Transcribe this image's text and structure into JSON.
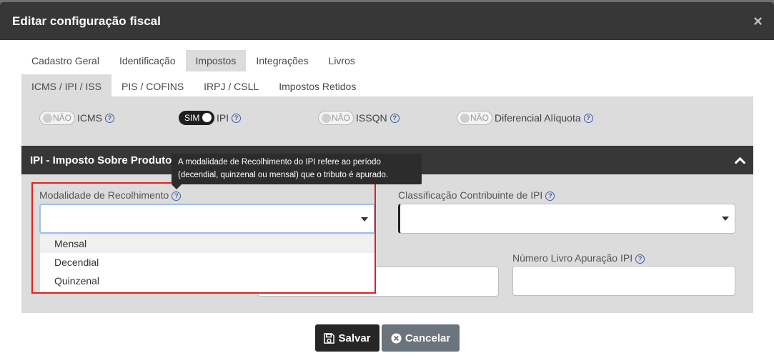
{
  "modal": {
    "title": "Editar configuração fiscal",
    "close": "×"
  },
  "tabs_main": [
    "Cadastro Geral",
    "Identificação",
    "Impostos",
    "Integrações",
    "Livros"
  ],
  "tabs_sub": [
    "ICMS / IPI / ISS",
    "PIS / COFINS",
    "IRPJ / CSLL",
    "Impostos Retidos"
  ],
  "toggles": [
    {
      "state": "NÃO",
      "label": "ICMS"
    },
    {
      "state": "SIM",
      "label": "IPI"
    },
    {
      "state": "NÃO",
      "label": "ISSQN"
    },
    {
      "state": "NÃO",
      "label": "Diferencial Alíquota"
    }
  ],
  "help_glyph": "?",
  "section": {
    "title": "IPI - Imposto Sobre Produtos"
  },
  "tooltip": {
    "line1": "A modalidade de Recolhimento do IPI refere ao período",
    "line2": "(decendial, quinzenal ou mensal) que o tributo é apurado."
  },
  "fields": {
    "modalidade_label": "Modalidade de Recolhimento",
    "classificacao_label": "Classificação Contribuinte de IPI",
    "numero_livro_label": "Número Livro Apuração IPI"
  },
  "dropdown_options": [
    "Mensal",
    "Decendial",
    "Quinzenal"
  ],
  "buttons": {
    "save": "Salvar",
    "cancel": "Cancelar"
  },
  "colors": {
    "header": "#373737",
    "panel": "#dcdcdc",
    "highlight": "#e02020",
    "cancel": "#6b737c"
  }
}
